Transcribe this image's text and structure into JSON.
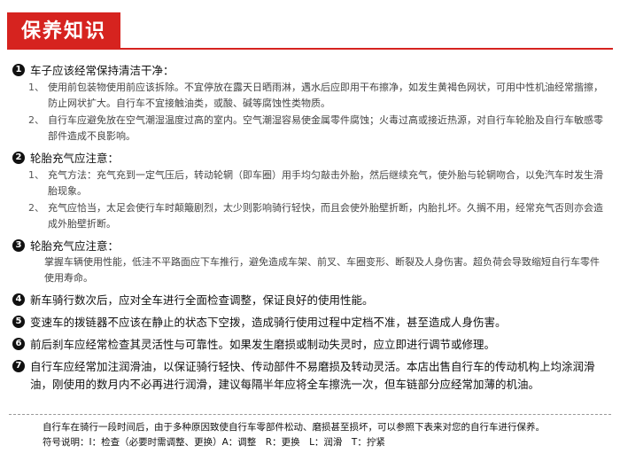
{
  "title": "保养知识",
  "sections": [
    {
      "num": "1",
      "heading": "车子应该经常保持清洁干净：",
      "items": [
        {
          "idx": "1、",
          "text": "使用前包装物使用前应该拆除。不宜停放在露天日晒雨淋，遇水后应即用干布擦净，如发生黄褐色网状，可用中性机油经常揩擦，防止网状扩大。自行车不宜接触油类，或酸、碱等腐蚀性类物质。"
        },
        {
          "idx": "2、",
          "text": "自行车应避免放在空气潮湿温度过高的室内。空气潮湿容易使金属零件腐蚀；火毒过高或接近热源，对自行车轮胎及自行车敏感零部件造成不良影响。"
        }
      ]
    },
    {
      "num": "2",
      "heading": "轮胎充气应注意：",
      "items": [
        {
          "idx": "1、",
          "text": "充气方法：充气充到一定气压后，转动轮辋（即车圈）用手均匀敲击外胎，然后继续充气，使外胎与轮辋吻合，以免汽车时发生滑胎现象。"
        },
        {
          "idx": "2、",
          "text": "充气应恰当，太足会使行车时颠簸剧烈，太少则影响骑行轻快，而且会使外胎壁折断，内胎扎坏。久搁不用，经常充气否则亦会造成外胎壁折断。"
        }
      ]
    },
    {
      "num": "3",
      "heading": "轮胎充气应注意：",
      "plain": "掌握车辆使用性能，低洼不平路面应下车推行，避免造成车架、前叉、车圈变形、断裂及人身伤害。超负荷会导致缩短自行车零件使用寿命。"
    },
    {
      "num": "4",
      "heading": "新车骑行数次后，应对全车进行全面检查调整，保证良好的使用性能。"
    },
    {
      "num": "5",
      "heading": "变速车的拨链器不应该在静止的状态下空拨，造成骑行使用过程中定档不准，甚至造成人身伤害。"
    },
    {
      "num": "6",
      "heading": "前后刹车应经常检查其灵活性与可靠性。如果发生磨损或制动失灵时，应立即进行调节或修理。"
    },
    {
      "num": "7",
      "heading": "自行车应经常加注润滑油，以保证骑行轻快、传动部件不易磨损及转动灵活。本店出售自行车的传动机构上均涂润滑油，刚使用的数月内不必再进行润滑，建议每隔半年应将全车擦洗一次，但车链部分应经常加薄的机油。"
    }
  ],
  "footer": {
    "line1": "自行车在骑行一段时间后，由于多种原因致使自行车零部件松动、磨损甚至损坏，可以参照下表来对您的自行车进行保养。",
    "line2": "符号说明：I：检查（必要时需调整、更换）A：调整　R：更换　L：润滑　T：拧紧"
  }
}
